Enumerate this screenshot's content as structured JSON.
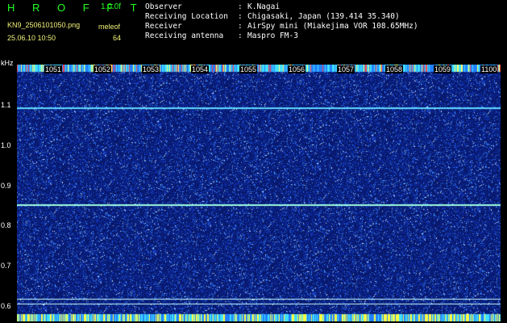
{
  "header": {
    "title": "H R O F F T",
    "version": "1.0.0f",
    "filename": "KN9_2506101050.png",
    "datetime": "25.06.10 10:50",
    "param_label": "meleof",
    "param_value": "64"
  },
  "info": [
    {
      "key": "Observer",
      "value": "K.Nagai"
    },
    {
      "key": "Receiving Location",
      "value": "Chigasaki, Japan (139.414 35.340)"
    },
    {
      "key": "Receiver",
      "value": "AirSpy mini (Miakejima VOR 108.65MHz)"
    },
    {
      "key": "Receiving antenna",
      "value": "Maspro FM-3"
    }
  ],
  "info_separator": ":",
  "axis": {
    "unit": "kHz",
    "y_ticks": [
      "1.1",
      "1.0",
      "0.9",
      "0.8",
      "0.7",
      "0.6"
    ],
    "x_ticks": [
      "1051",
      "1052",
      "1053",
      "1054",
      "1055",
      "1056",
      "1057",
      "1058",
      "1059",
      "1100"
    ]
  },
  "colors": {
    "background": "#000000",
    "plot": "#081868",
    "title": "#22ff22",
    "label": "#f2f27a",
    "text": "#ffffff",
    "line": "#5fd8ff"
  }
}
